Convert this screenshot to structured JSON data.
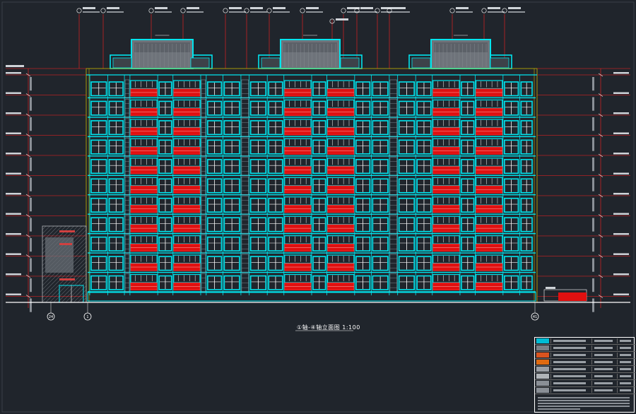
{
  "drawing": {
    "caption": "①轴-④轴立面图 1:100",
    "axis_left_labels": [
      "24",
      "1"
    ],
    "axis_right_label": "41"
  },
  "colors": {
    "background": "#20252c",
    "wall_cyan": "#00e5ee",
    "glazing_red": "#e01010",
    "dimension_red": "#ff2020",
    "roof_gray": "#6e737a",
    "guideline_yellow": "#c8b400",
    "window_white": "#ffffff",
    "legend_orange": "#e06a10"
  },
  "elevation": {
    "floors": 11,
    "bays": 3
  },
  "legend": {
    "rows": 8,
    "swatches": [
      "#00bcd4",
      "#7a7f86",
      "#d9531e",
      "#e06a10",
      "#9a9ea4",
      "#b0b4b8",
      "#8a8f96",
      "#8a8f96"
    ]
  }
}
